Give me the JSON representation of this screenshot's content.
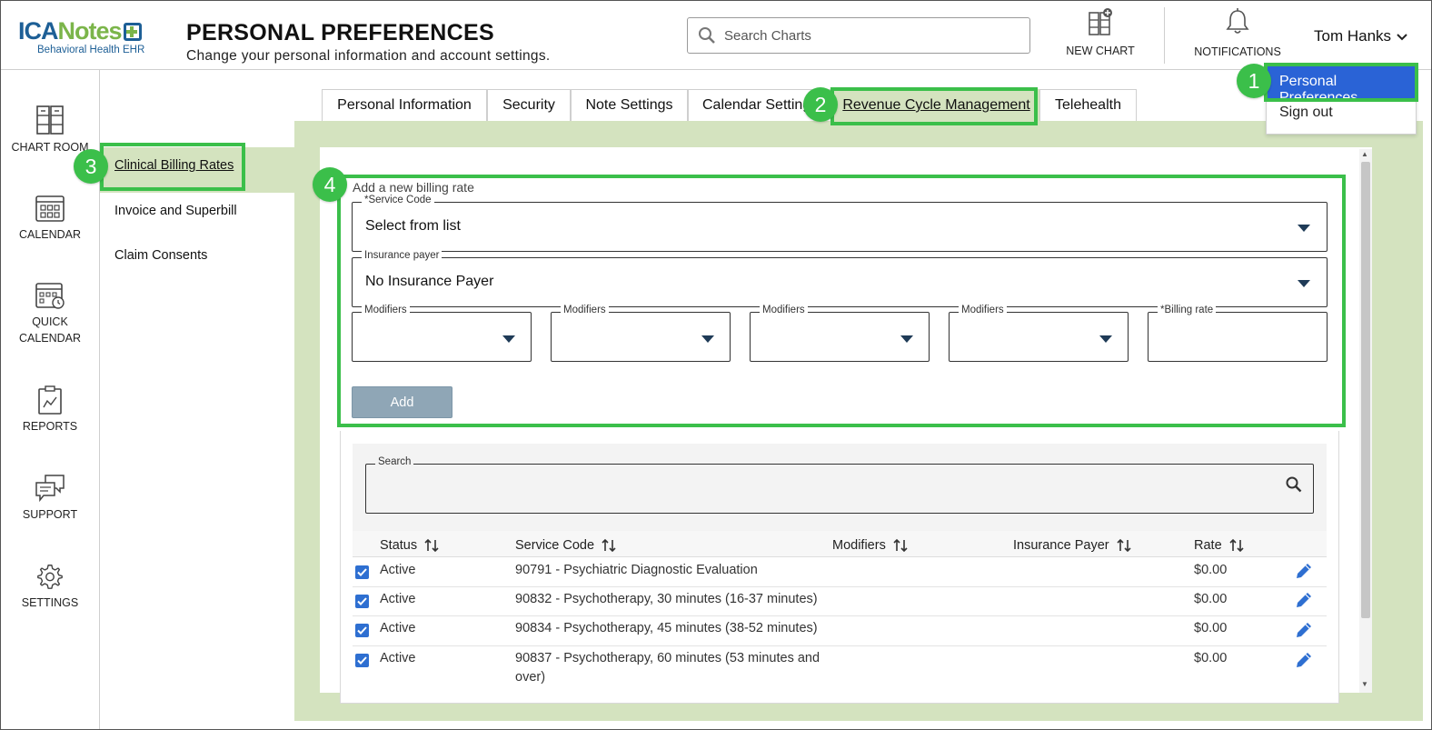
{
  "header": {
    "logo_text_a": "ICA",
    "logo_text_b": "Notes",
    "logo_sub": "Behavioral Health EHR",
    "title": "PERSONAL PREFERENCES",
    "subtitle": "Change your personal information and account settings.",
    "search_placeholder": "Search Charts",
    "new_chart_label": "NEW CHART",
    "notifications_label": "NOTIFICATIONS",
    "user_name": "Tom Hanks"
  },
  "user_menu": {
    "personal_preferences": "Personal Preferences",
    "sign_out": "Sign out"
  },
  "leftnav": {
    "chart_room": "CHART ROOM",
    "calendar": "CALENDAR",
    "quick_calendar_1": "QUICK",
    "quick_calendar_2": "CALENDAR",
    "reports": "REPORTS",
    "support": "SUPPORT",
    "settings": "SETTINGS"
  },
  "subnav": {
    "items": [
      "Clinical Billing Rates",
      "Invoice and Superbill",
      "Claim Consents"
    ]
  },
  "tabs": [
    "Personal Information",
    "Security",
    "Note Settings",
    "Calendar Settings",
    "Revenue Cycle Management",
    "Telehealth"
  ],
  "form": {
    "heading": "Add a new billing rate",
    "service_code_label": "*Service Code",
    "service_code_value": "Select from list",
    "insurance_payer_label": "Insurance payer",
    "insurance_payer_value": "No Insurance Payer",
    "modifiers_label": "Modifiers",
    "billing_rate_label": "*Billing rate",
    "add_button": "Add"
  },
  "list": {
    "search_label": "Search",
    "columns": [
      "Status",
      "Service Code",
      "Modifiers",
      "Insurance Payer",
      "Rate"
    ],
    "rows": [
      {
        "status": "Active",
        "service_code_1": "90791 - Psychiatric Diagnostic Evaluation",
        "service_code_2": "",
        "rate": "$0.00"
      },
      {
        "status": "Active",
        "service_code_1": "90832 - Psychotherapy, 30 minutes (16-37 minutes)",
        "service_code_2": "",
        "rate": "$0.00"
      },
      {
        "status": "Active",
        "service_code_1": "90834 - Psychotherapy, 45 minutes (38-52 minutes)",
        "service_code_2": "",
        "rate": "$0.00"
      },
      {
        "status": "Active",
        "service_code_1": "90837 - Psychotherapy, 60 minutes (53 minutes and",
        "service_code_2": "over)",
        "rate": "$0.00"
      }
    ]
  },
  "annotations": [
    "1",
    "2",
    "3",
    "4"
  ],
  "colors": {
    "accent_green": "#3bbf4a",
    "panel_green": "#d4e3bf",
    "menu_blue": "#2a63d6",
    "brand_blue": "#1d5f96"
  }
}
